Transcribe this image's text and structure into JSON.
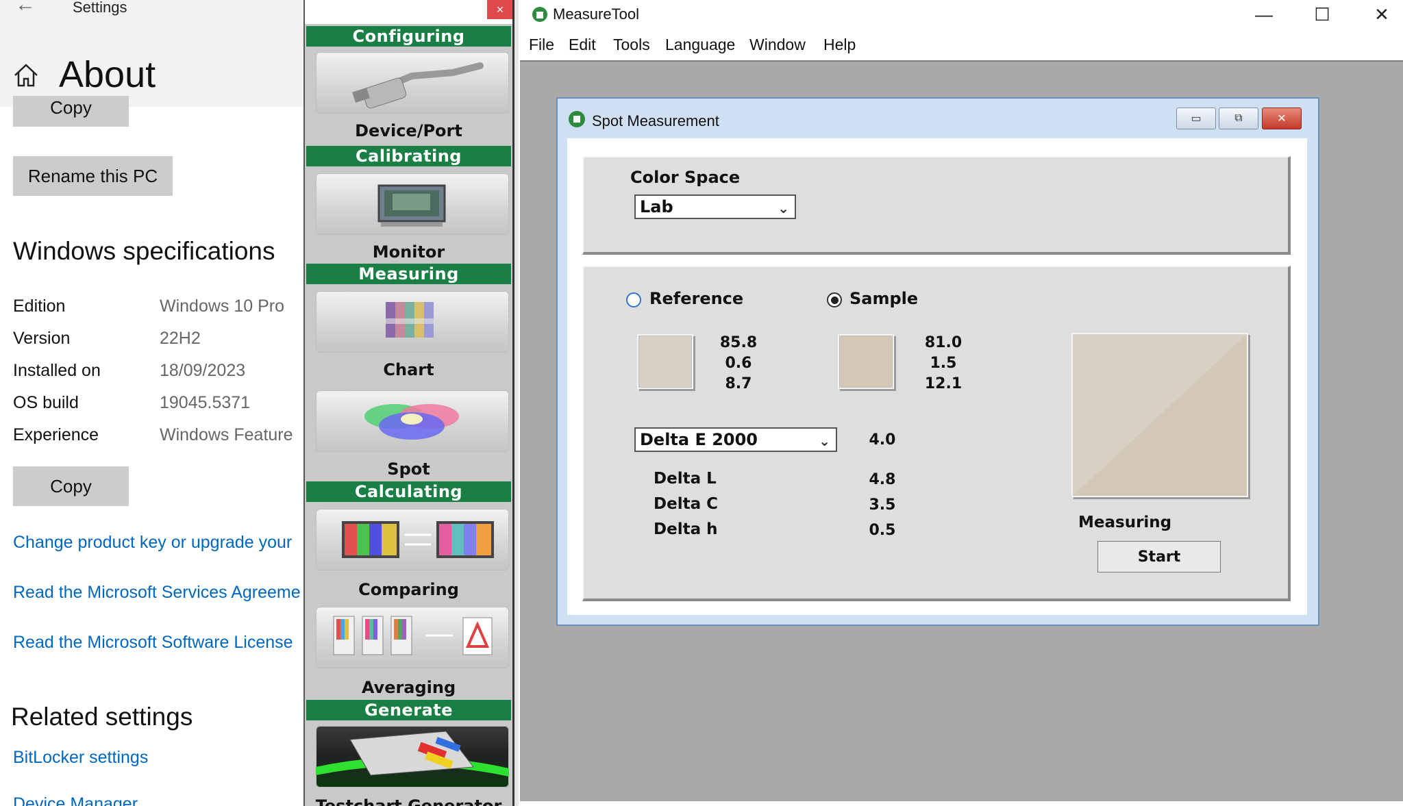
{
  "settings": {
    "app_title": "Settings",
    "page_title": "About",
    "copy_top_label": "Copy",
    "rename_label": "Rename this PC",
    "specs_heading": "Windows specifications",
    "specs": [
      {
        "key": "Edition",
        "value": "Windows 10 Pro"
      },
      {
        "key": "Version",
        "value": "22H2"
      },
      {
        "key": "Installed on",
        "value": "18/09/2023"
      },
      {
        "key": "OS build",
        "value": "19045.5371"
      },
      {
        "key": "Experience",
        "value": "Windows Feature"
      }
    ],
    "copy_label": "Copy",
    "links": [
      "Change product key or upgrade your",
      "Read the Microsoft Services Agreeme",
      "Read the Microsoft Software License"
    ],
    "related_heading": "Related settings",
    "related_links": [
      "BitLocker settings",
      "Device Manager"
    ]
  },
  "nav": {
    "close_label": "×",
    "sections": {
      "configuring": "Configuring",
      "calibrating": "Calibrating",
      "measuring": "Measuring",
      "calculating": "Calculating",
      "generate": "Generate"
    },
    "items": {
      "device_port": "Device/Port",
      "monitor": "Monitor",
      "chart": "Chart",
      "spot": "Spot",
      "comparing": "Comparing",
      "averaging": "Averaging",
      "bottom_partial": "Testchart Generator"
    }
  },
  "measuretool": {
    "title": "MeasureTool",
    "controls": {
      "minimize": "—",
      "maximize": "☐",
      "close": "✕"
    },
    "menu": [
      "File",
      "Edit",
      "Tools",
      "Language",
      "Window",
      "Help"
    ],
    "spot": {
      "title": "Spot Measurement",
      "color_space_label": "Color Space",
      "color_space_value": "Lab",
      "reference_label": "Reference",
      "sample_label": "Sample",
      "selected": "Sample",
      "reference_values": [
        "85.8",
        "0.6",
        "8.7"
      ],
      "sample_values": [
        "81.0",
        "1.5",
        "12.1"
      ],
      "delta_method": "Delta E 2000",
      "delta_e_value": "4.0",
      "deltas": [
        {
          "label": "Delta L",
          "value": "4.8"
        },
        {
          "label": "Delta C",
          "value": "3.5"
        },
        {
          "label": "Delta h",
          "value": "0.5"
        }
      ],
      "measuring_label": "Measuring",
      "start_label": "Start",
      "reference_color": "#d8d0c5",
      "sample_color": "#d3c8b5"
    }
  }
}
